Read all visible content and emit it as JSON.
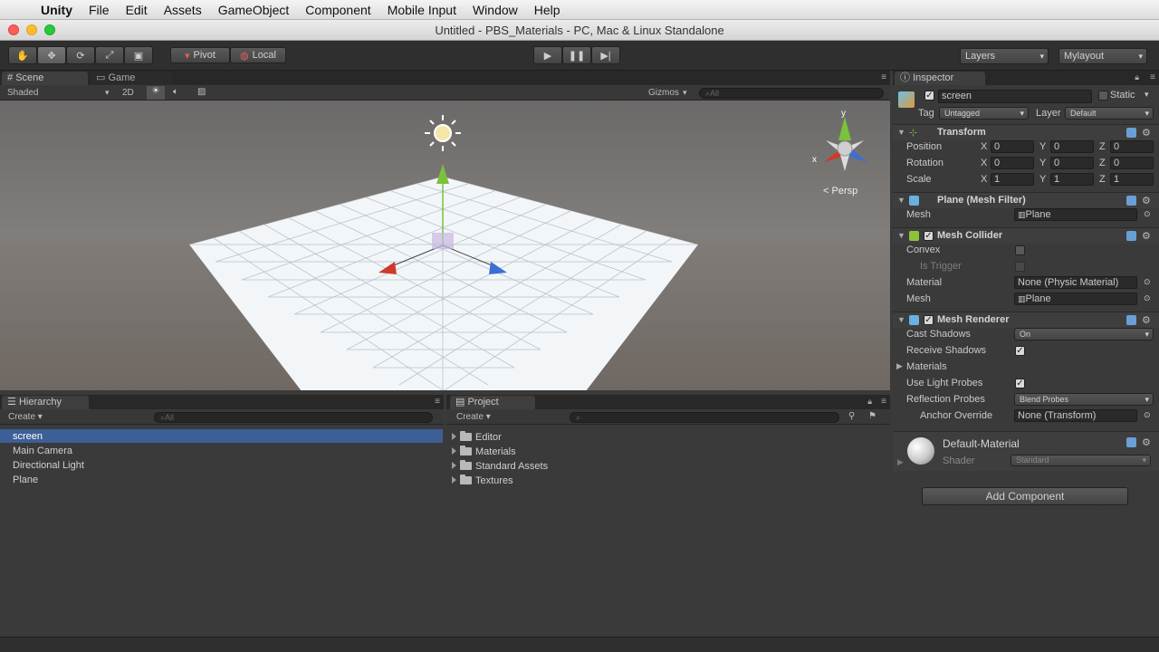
{
  "menubar": {
    "app": "Unity",
    "items": [
      "File",
      "Edit",
      "Assets",
      "GameObject",
      "Component",
      "Mobile Input",
      "Window",
      "Help"
    ]
  },
  "window": {
    "title": "Untitled - PBS_Materials - PC, Mac & Linux Standalone"
  },
  "toolbar": {
    "pivot": "Pivot",
    "local": "Local",
    "layers": "Layers",
    "layout": "Mylayout"
  },
  "scene": {
    "tab": "Scene",
    "game_tab": "Game",
    "shading": "Shaded",
    "mode_2d": "2D",
    "gizmos": "Gizmos",
    "search_placeholder": "All",
    "persp": "Persp",
    "axis_x": "x",
    "axis_y": "y"
  },
  "hierarchy": {
    "tab": "Hierarchy",
    "create": "Create",
    "search_placeholder": "All",
    "items": [
      "screen",
      "Main Camera",
      "Directional Light",
      "Plane"
    ],
    "selected": "screen"
  },
  "project": {
    "tab": "Project",
    "create": "Create",
    "folders": [
      "Editor",
      "Materials",
      "Standard Assets",
      "Textures"
    ]
  },
  "inspector": {
    "tab": "Inspector",
    "object_name": "screen",
    "static_label": "Static",
    "tag_label": "Tag",
    "tag_value": "Untagged",
    "layer_label": "Layer",
    "layer_value": "Default",
    "transform": {
      "title": "Transform",
      "rows": [
        {
          "label": "Position",
          "x": "0",
          "y": "0",
          "z": "0"
        },
        {
          "label": "Rotation",
          "x": "0",
          "y": "0",
          "z": "0"
        },
        {
          "label": "Scale",
          "x": "1",
          "y": "1",
          "z": "1"
        }
      ],
      "x_label": "X",
      "y_label": "Y",
      "z_label": "Z"
    },
    "mesh_filter": {
      "title": "Plane (Mesh Filter)",
      "mesh_label": "Mesh",
      "mesh_value": "Plane"
    },
    "mesh_collider": {
      "title": "Mesh Collider",
      "convex": "Convex",
      "is_trigger": "Is Trigger",
      "material_label": "Material",
      "material_value": "None (Physic Material)",
      "mesh_label": "Mesh",
      "mesh_value": "Plane"
    },
    "mesh_renderer": {
      "title": "Mesh Renderer",
      "cast_shadows": "Cast Shadows",
      "cast_shadows_value": "On",
      "receive_shadows": "Receive Shadows",
      "materials": "Materials",
      "use_light_probes": "Use Light Probes",
      "reflection_probes": "Reflection Probes",
      "reflection_probes_value": "Blend Probes",
      "anchor_override": "Anchor Override",
      "anchor_override_value": "None (Transform)"
    },
    "material": {
      "name": "Default-Material",
      "shader_label": "Shader",
      "shader_value": "Standard"
    },
    "add_component": "Add Component"
  },
  "colors": {
    "selection": "#3d5f97",
    "axis_x": "#d13a2a",
    "axis_y": "#7ac23a",
    "axis_z": "#3a6fd4"
  }
}
